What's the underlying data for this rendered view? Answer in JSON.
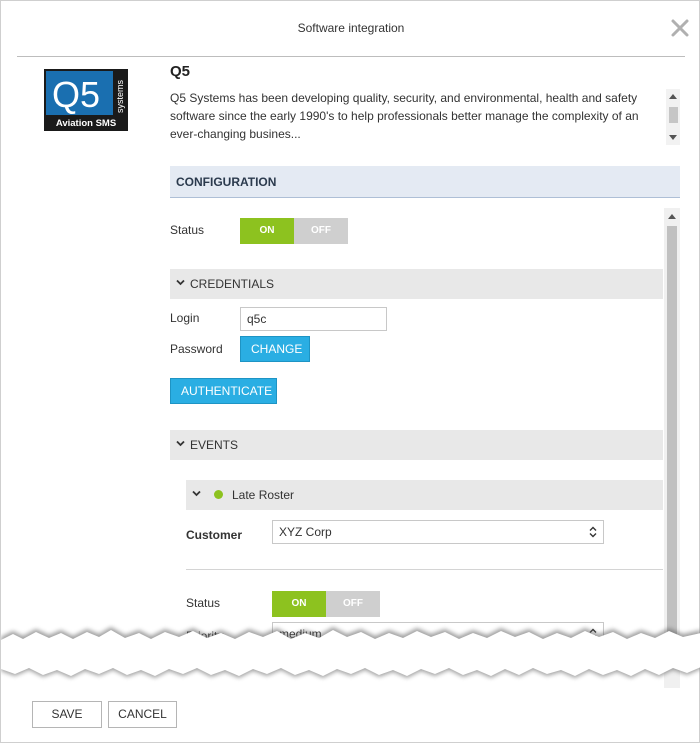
{
  "dialog": {
    "title": "Software integration",
    "close_icon": "close-icon"
  },
  "app": {
    "name": "Q5",
    "logo": {
      "icon": "q5-systems-logo",
      "big_text": "Q5",
      "side_text": "systems",
      "bottom_text": "Aviation SMS",
      "colors": {
        "background": "#1a1a1a",
        "panel": "#1a6fb0"
      }
    },
    "description": "Q5 Systems has been developing quality, security, and environmental, health and safety software since the early 1990's to help professionals better manage the complexity of an ever-changing busines..."
  },
  "configuration": {
    "header": "CONFIGURATION",
    "status_label": "Status",
    "status_on": "ON",
    "status_off": "OFF",
    "status_value": "ON",
    "credentials": {
      "header": "CREDENTIALS",
      "login_label": "Login",
      "login_value": "q5c",
      "password_label": "Password",
      "change_button": "CHANGE",
      "authenticate_button": "AUTHENTICATE"
    },
    "events": {
      "header": "EVENTS",
      "items": [
        {
          "name": "Late Roster",
          "status_dot_color": "#8dc21f",
          "customer_label": "Customer",
          "customer_value": "XYZ Corp",
          "status_label": "Status",
          "status_on": "ON",
          "status_off": "OFF",
          "status_value": "ON",
          "priority_label": "Priority",
          "priority_value": "medium"
        }
      ]
    }
  },
  "footer": {
    "save_button": "SAVE",
    "cancel_button": "CANCEL"
  },
  "colors": {
    "toggle_on": "#8dc21f",
    "toggle_off": "#cfcfcf",
    "button_blue": "#2aaee3",
    "config_header_bg": "#e4eaf3"
  }
}
